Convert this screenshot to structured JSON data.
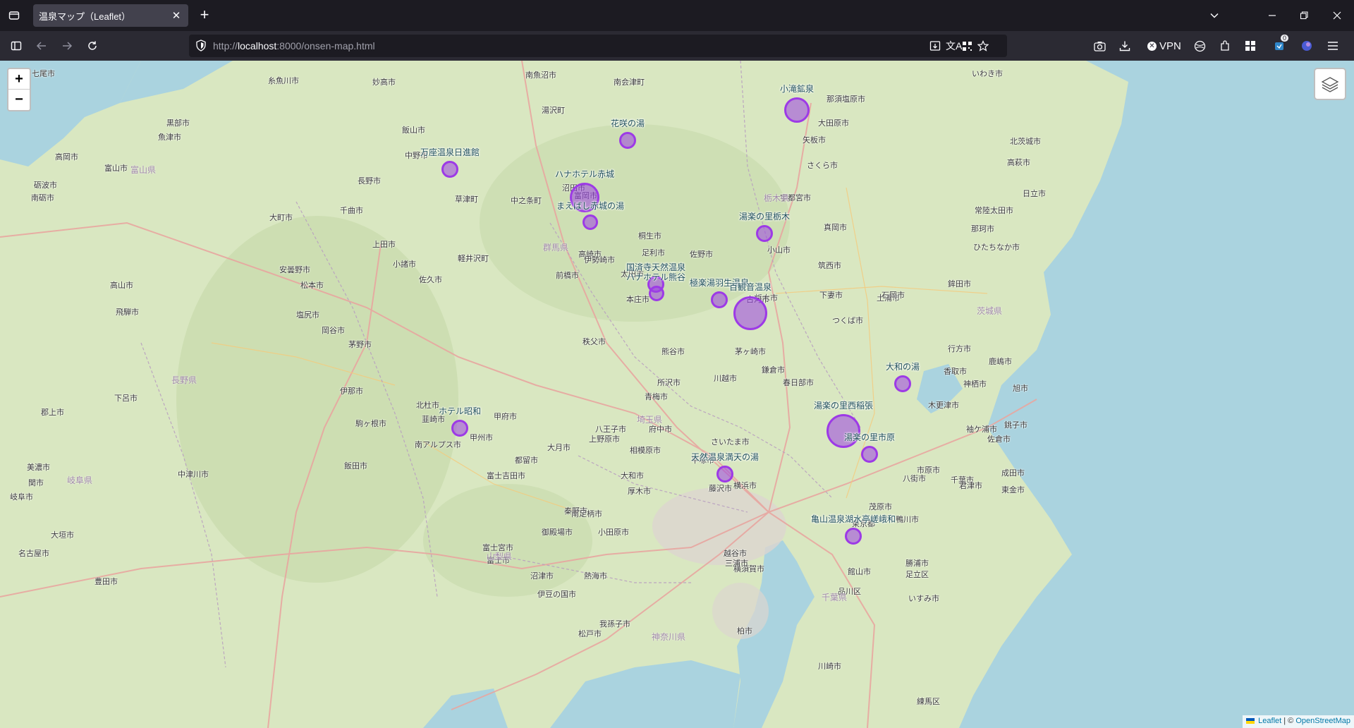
{
  "browser": {
    "tab_title": "温泉マップ（Leaflet）",
    "tab_close": "✕",
    "new_tab": "+",
    "url_prefix": "http://",
    "url_host": "localhost",
    "url_path": ":8000/onsen-map.html",
    "vpn_label": "VPN",
    "extensions_badge": "0"
  },
  "map": {
    "zoom_in": "+",
    "zoom_out": "−",
    "attribution_leaflet": "Leaflet",
    "attribution_sep": " | © ",
    "attribution_osm": "OpenStreetMap",
    "colors": {
      "land": "#dbe8c4",
      "water": "#aad3df",
      "road": "#e8a6a0",
      "marker": "#9d3ae6"
    },
    "places": [
      "七尾市",
      "糸魚川市",
      "妙高市",
      "南魚沼市",
      "湯沢町",
      "南会津町",
      "那須塩原市",
      "いわき市",
      "大田原市",
      "矢板市",
      "北茨城市",
      "高萩市",
      "日立市",
      "常陸太田市",
      "那珂市",
      "ひたちなか市",
      "黒部市",
      "魚津市",
      "富山市",
      "高岡市",
      "砺波市",
      "南砺市",
      "飯山市",
      "中野市",
      "長野市",
      "千曲市",
      "上田市",
      "小諸市",
      "佐久市",
      "軽井沢町",
      "安曇野市",
      "松本市",
      "大町市",
      "塩尻市",
      "岡谷市",
      "茅野市",
      "伊那市",
      "駒ヶ根市",
      "飯田市",
      "高山市",
      "飛騨市",
      "下呂市",
      "郡上市",
      "美濃市",
      "関市",
      "岐阜市",
      "大垣市",
      "名古屋市",
      "豊田市",
      "中津川市",
      "北杜市",
      "韮崎市",
      "甲府市",
      "甲州市",
      "南アルプス市",
      "富士吉田市",
      "都留市",
      "大月市",
      "上野原市",
      "秦野市",
      "御殿場市",
      "富士宮市",
      "富士市",
      "沼津市",
      "伊豆の国市",
      "熱海市",
      "小田原市",
      "南足柄市",
      "厚木市",
      "大和市",
      "藤沢市",
      "横浜市",
      "横須賀市",
      "三浦市",
      "相模原市",
      "八王子市",
      "府中市",
      "青梅市",
      "所沢市",
      "川越市",
      "さいたま市",
      "熊谷市",
      "本庄市",
      "秩父市",
      "前橋市",
      "高崎市",
      "富岡市",
      "沼田市",
      "中之条町",
      "草津町",
      "伊勢崎市",
      "太田市",
      "桐生市",
      "足利市",
      "佐野市",
      "小山市",
      "栃木市",
      "宇都宮市",
      "さくら市",
      "真岡市",
      "筑西市",
      "古河市",
      "下妻市",
      "つくば市",
      "土浦市",
      "石岡市",
      "鉾田市",
      "行方市",
      "鹿嶋市",
      "神栖市",
      "成田市",
      "香取市",
      "旭市",
      "銚子市",
      "佐倉市",
      "八街市",
      "千葉市",
      "東金市",
      "市原市",
      "茂原市",
      "木更津市",
      "君津市",
      "袖ケ浦市",
      "いすみ市",
      "勝浦市",
      "鴨川市",
      "館山市",
      "東京都",
      "品川区",
      "練馬区",
      "足立区",
      "川崎市",
      "鎌倉市",
      "茅ヶ崎市",
      "平塚市",
      "春日部市",
      "越谷市",
      "柏市",
      "松戸市",
      "我孫子市"
    ],
    "prefectures": [
      "群馬県",
      "栃木県",
      "茨城県",
      "埼玉県",
      "千葉県",
      "神奈川県",
      "山梨県",
      "長野県",
      "富山県",
      "岐阜県"
    ],
    "onsen": [
      {
        "name": "小滝鉱泉"
      },
      {
        "name": "花咲の湯"
      },
      {
        "name": "万座温泉日進館"
      },
      {
        "name": "ハナホテル赤城"
      },
      {
        "name": "まえばし赤城の湯"
      },
      {
        "name": "湯楽の里栃木"
      },
      {
        "name": "国済寺天然温泉"
      },
      {
        "name": "ハナホテル熊谷"
      },
      {
        "name": "極楽湯羽生温泉"
      },
      {
        "name": "百観音温泉"
      },
      {
        "name": "大和の湯"
      },
      {
        "name": "ホテル昭和"
      },
      {
        "name": "湯楽の里西稲張"
      },
      {
        "name": "湯楽の里市原"
      },
      {
        "name": "天然温泉満天の湯"
      },
      {
        "name": "亀山温泉湖水亭嵯峨和"
      }
    ]
  }
}
